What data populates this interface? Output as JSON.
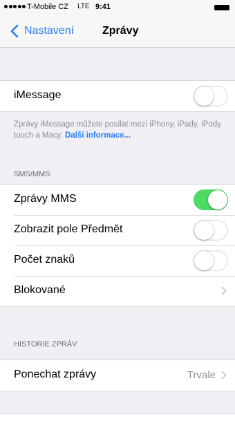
{
  "status_bar": {
    "carrier": "T-Mobile CZ",
    "network": "LTE",
    "time": "9:41"
  },
  "nav": {
    "back_label": "Nastavení",
    "title": "Zprávy"
  },
  "imessage": {
    "label": "iMessage",
    "enabled": false,
    "footer_text": "Zprávy iMessage můžete posílat mezi iPhony, iPady, iPody touch a Macy. ",
    "footer_link": "Další informace..."
  },
  "sms_section": {
    "header": "SMS/MMS",
    "items": [
      {
        "label": "Zprávy MMS",
        "type": "toggle",
        "enabled": true
      },
      {
        "label": "Zobrazit pole Předmět",
        "type": "toggle",
        "enabled": false
      },
      {
        "label": "Počet znaků",
        "type": "toggle",
        "enabled": false
      },
      {
        "label": "Blokované",
        "type": "disclosure"
      }
    ]
  },
  "history_section": {
    "header": "HISTORIE ZPRÁV",
    "items": [
      {
        "label": "Ponechat zprávy",
        "value": "Trvale",
        "type": "disclosure"
      }
    ]
  },
  "colors": {
    "accent": "#2a7ef7",
    "switch_on": "#4cd964",
    "background": "#efeff4"
  }
}
